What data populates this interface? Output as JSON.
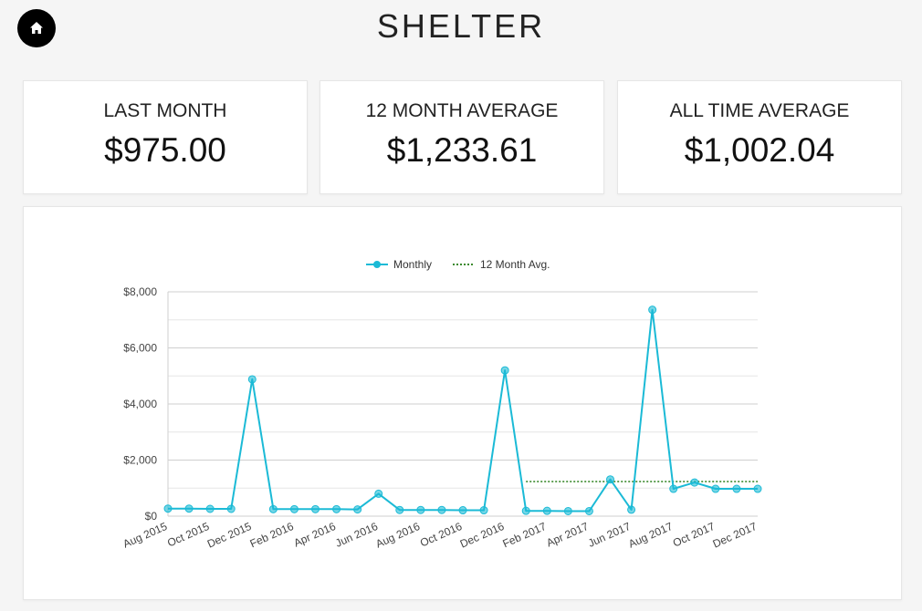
{
  "header": {
    "title": "SHELTER",
    "home_icon": "home-icon"
  },
  "stats": [
    {
      "label": "LAST MONTH",
      "value": "$975.00"
    },
    {
      "label": "12 MONTH AVERAGE",
      "value": "$1,233.61"
    },
    {
      "label": "ALL TIME AVERAGE",
      "value": "$1,002.04"
    }
  ],
  "chart_data": {
    "type": "line",
    "legend_placement": "top-center",
    "grid": true,
    "ylim": [
      0,
      8000
    ],
    "yticks": [
      0,
      2000,
      4000,
      6000,
      8000
    ],
    "ytick_labels": [
      "$0",
      "$2,000",
      "$4,000",
      "$6,000",
      "$8,000"
    ],
    "categories": [
      "Aug 2015",
      "Sep 2015",
      "Oct 2015",
      "Nov 2015",
      "Dec 2015",
      "Jan 2016",
      "Feb 2016",
      "Mar 2016",
      "Apr 2016",
      "May 2016",
      "Jun 2016",
      "Jul 2016",
      "Aug 2016",
      "Sep 2016",
      "Oct 2016",
      "Nov 2016",
      "Dec 2016",
      "Jan 2017",
      "Feb 2017",
      "Mar 2017",
      "Apr 2017",
      "May 2017",
      "Jun 2017",
      "Jul 2017",
      "Aug 2017",
      "Sep 2017",
      "Oct 2017",
      "Nov 2017",
      "Dec 2017"
    ],
    "xtick_labels": [
      "Aug 2015",
      "Oct 2015",
      "Dec 2015",
      "Feb 2016",
      "Apr 2016",
      "Jun 2016",
      "Aug 2016",
      "Oct 2016",
      "Dec 2016",
      "Feb 2017",
      "Apr 2017",
      "Jun 2017",
      "Aug 2017",
      "Oct 2017",
      "Dec 2017"
    ],
    "series": [
      {
        "name": "Monthly",
        "color": "#1bbad6",
        "style": "solid",
        "values": [
          270,
          270,
          260,
          260,
          4880,
          250,
          250,
          250,
          250,
          240,
          800,
          220,
          220,
          220,
          210,
          210,
          5200,
          190,
          190,
          180,
          180,
          1310,
          230,
          7360,
          975,
          1200,
          975,
          975,
          975
        ]
      },
      {
        "name": "12 Month Avg.",
        "color": "#3c8a2e",
        "style": "dotted",
        "start_category": "Jan 2017",
        "value": 1233.61
      }
    ]
  }
}
